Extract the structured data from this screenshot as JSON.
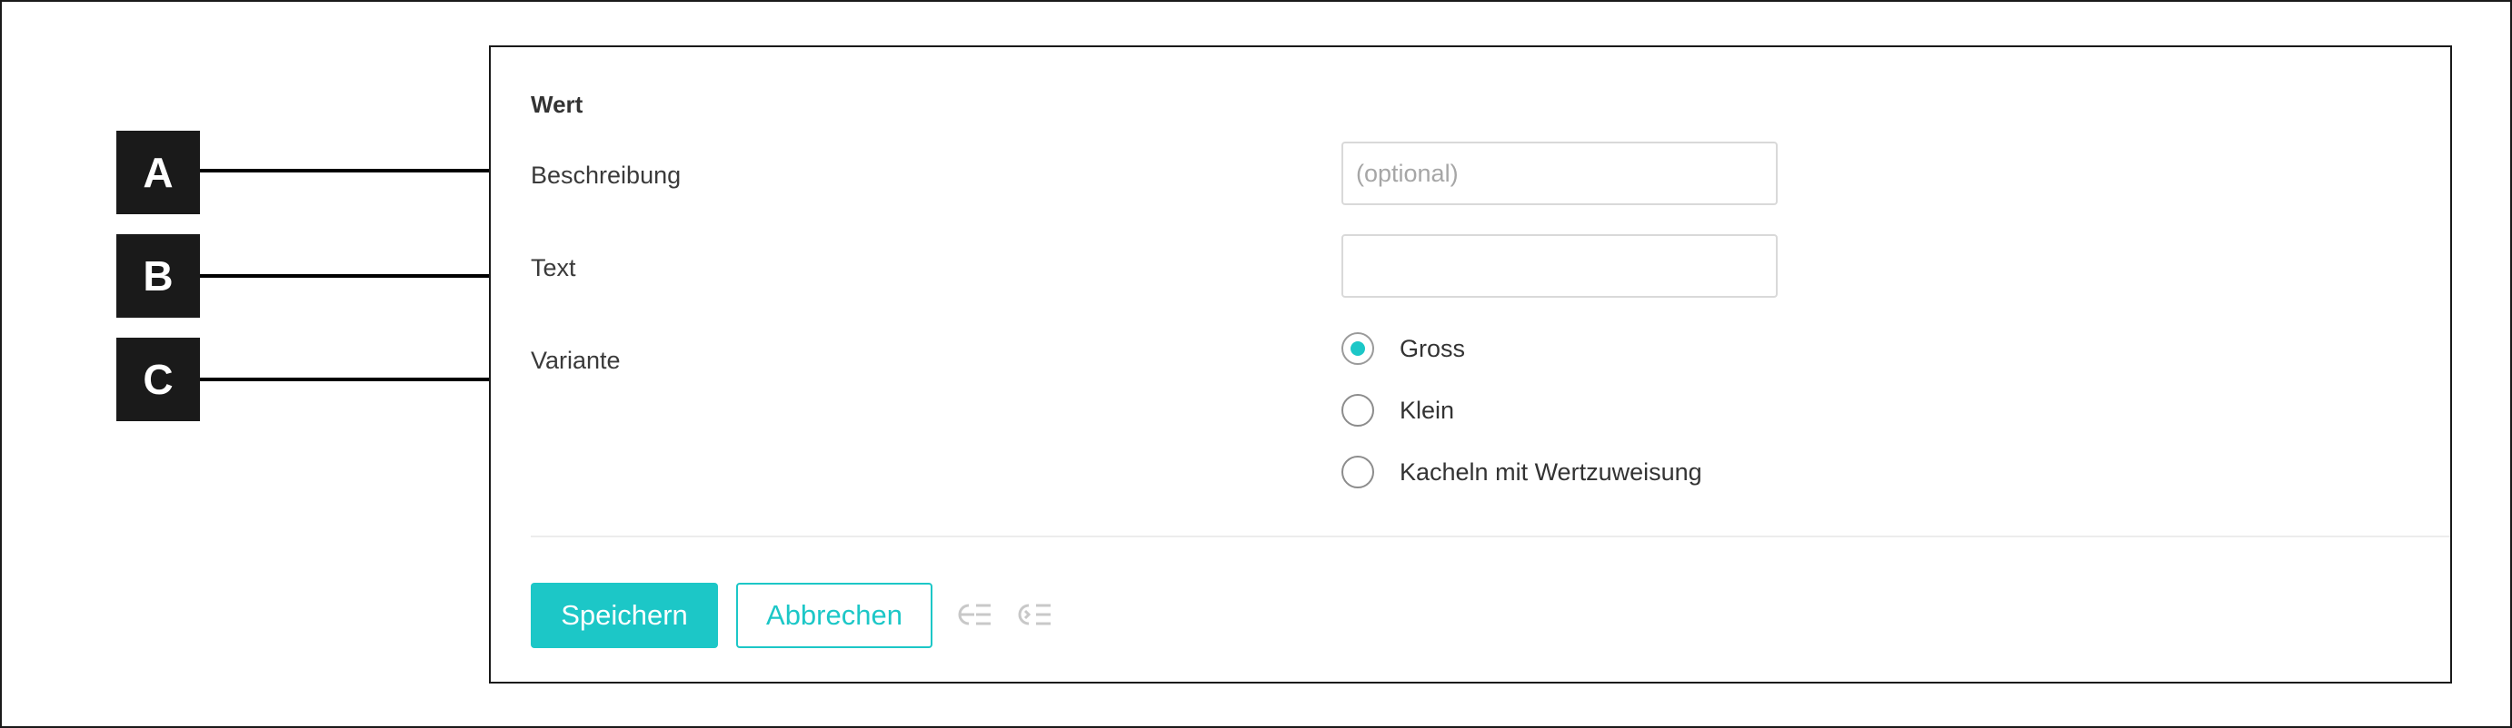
{
  "form": {
    "section_title": "Wert",
    "fields": {
      "beschreibung": {
        "label": "Beschreibung",
        "placeholder": "(optional)",
        "value": ""
      },
      "text": {
        "label": "Text",
        "value": ""
      },
      "variante": {
        "label": "Variante",
        "options": [
          {
            "label": "Gross",
            "checked": true
          },
          {
            "label": "Klein",
            "checked": false
          },
          {
            "label": "Kacheln mit Wertzuweisung",
            "checked": false
          }
        ]
      }
    },
    "buttons": {
      "save": "Speichern",
      "cancel": "Abbrechen"
    },
    "toolbar_icons": [
      "outdent-icon",
      "indent-icon"
    ]
  },
  "callouts": [
    "A",
    "B",
    "C"
  ],
  "colors": {
    "accent": "#1cc7c7",
    "callout_bg": "#1a1a1a",
    "icon_muted": "#c8c8c8"
  }
}
